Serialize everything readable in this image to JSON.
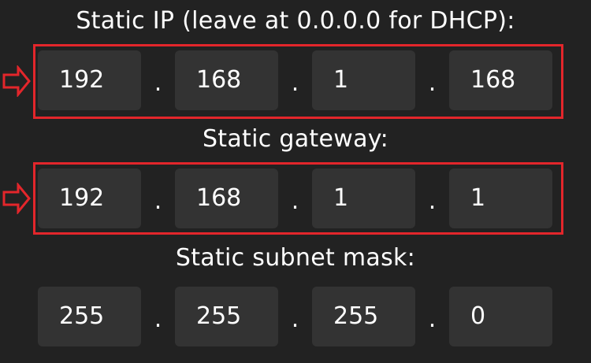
{
  "static_ip": {
    "label": "Static IP (leave at 0.0.0.0 for DHCP):",
    "octets": [
      "192",
      "168",
      "1",
      "168"
    ]
  },
  "static_gateway": {
    "label": "Static gateway:",
    "octets": [
      "192",
      "168",
      "1",
      "1"
    ]
  },
  "static_subnet_mask": {
    "label": "Static subnet mask:",
    "octets": [
      "255",
      "255",
      "255",
      "0"
    ]
  },
  "separator": ".",
  "colors": {
    "background": "#222222",
    "field_background": "#333333",
    "text": "#ffffff",
    "highlight": "#e3262b"
  },
  "annotations": {
    "icon": "right-arrow-outline-icon"
  }
}
